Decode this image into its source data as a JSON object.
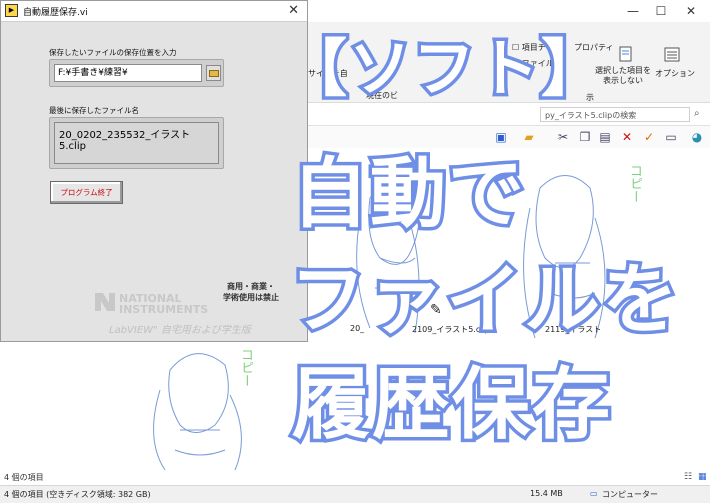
{
  "explorer": {
    "ribbon": {
      "item_checkbox": "項目チ",
      "file_name_ext": "ファイル名",
      "hide_selected": "選択した項目を\n表示しない",
      "options": "オプション",
      "size_fit": "のサイズを自",
      "current_view": "現在のビ",
      "show": "示",
      "properties": "プロパティ"
    },
    "search_placeholder": "py_イラスト5.clipの検索",
    "files": [
      {
        "name": "20_"
      },
      {
        "name": "2109_イラスト5.clip"
      },
      {
        "name": "2119_イラスト"
      }
    ],
    "sketch_copy_text": "コピー",
    "count_top": "4 個の項目",
    "status": {
      "items": "4 個の項目 (空きディスク領域: 382 GB)",
      "size": "15.4 MB",
      "location": "コンピューター"
    }
  },
  "labview": {
    "title": "自動履歴保存.vi",
    "save_location_label": "保存したいファイルの保存位置を入力",
    "path_value": "F:¥手書き¥練習¥",
    "last_saved_label": "最後に保存したファイル名",
    "last_saved_value": "20_0202_235532_イラスト5.clip",
    "exit_button": "プログラム終了",
    "restriction_note": "商用・商業・\n学術使用は禁止",
    "ni_logo_line1": "NATIONAL",
    "ni_logo_line2": "INSTRUMENTS",
    "labview_edition": "LabVIEW\" 自宅用および学生版"
  },
  "overlay": {
    "line1": "【ソフト】",
    "line2": "自動で",
    "line3": "ファイルを",
    "line4": "履歴保存"
  },
  "colors": {
    "overlay_stroke": "#6f8fe6",
    "sketch_line": "#7a9ad6",
    "copy_text": "#7fd07f",
    "exit_text": "#cc0000"
  }
}
